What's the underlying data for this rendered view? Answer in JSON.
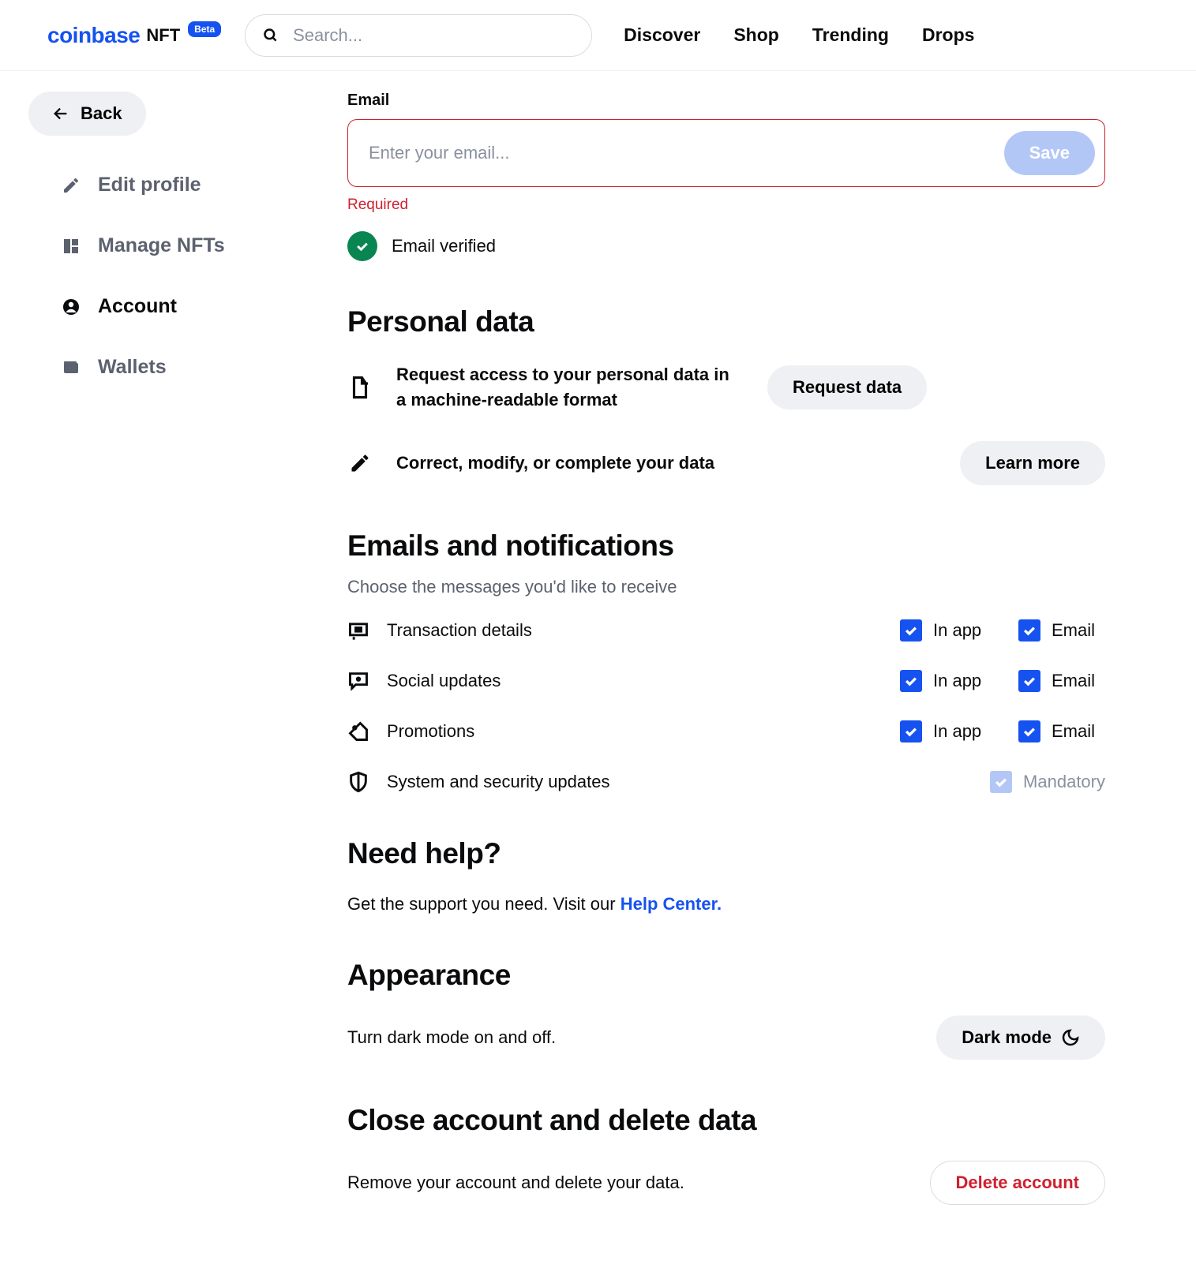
{
  "header": {
    "logo_brand": "coinbase",
    "logo_suffix": "NFT",
    "logo_badge": "Beta",
    "search_placeholder": "Search...",
    "nav": [
      "Discover",
      "Shop",
      "Trending",
      "Drops"
    ]
  },
  "sidebar": {
    "back": "Back",
    "items": [
      {
        "label": "Edit profile",
        "active": false
      },
      {
        "label": "Manage NFTs",
        "active": false
      },
      {
        "label": "Account",
        "active": true
      },
      {
        "label": "Wallets",
        "active": false
      }
    ]
  },
  "email": {
    "label": "Email",
    "placeholder": "Enter your email...",
    "save": "Save",
    "error": "Required",
    "verified": "Email verified"
  },
  "personal_data": {
    "heading": "Personal data",
    "request_text": "Request access to your personal data in a machine-readable format",
    "request_btn": "Request data",
    "correct_text": "Correct, modify, or complete your data",
    "learn_btn": "Learn more"
  },
  "notifications": {
    "heading": "Emails and notifications",
    "sub": "Choose the messages you'd like to receive",
    "rows": [
      {
        "label": "Transaction details",
        "inapp": true,
        "email": true
      },
      {
        "label": "Social updates",
        "inapp": true,
        "email": true
      },
      {
        "label": "Promotions",
        "inapp": true,
        "email": true
      },
      {
        "label": "System and security updates",
        "mandatory": true
      }
    ],
    "inapp_label": "In app",
    "email_label": "Email",
    "mandatory_label": "Mandatory"
  },
  "help": {
    "heading": "Need help?",
    "text": "Get the support you need. Visit our ",
    "link": "Help Center."
  },
  "appearance": {
    "heading": "Appearance",
    "text": "Turn dark mode on and off.",
    "btn": "Dark mode"
  },
  "close": {
    "heading": "Close account and delete data",
    "text": "Remove your account and delete your data.",
    "btn": "Delete account"
  }
}
